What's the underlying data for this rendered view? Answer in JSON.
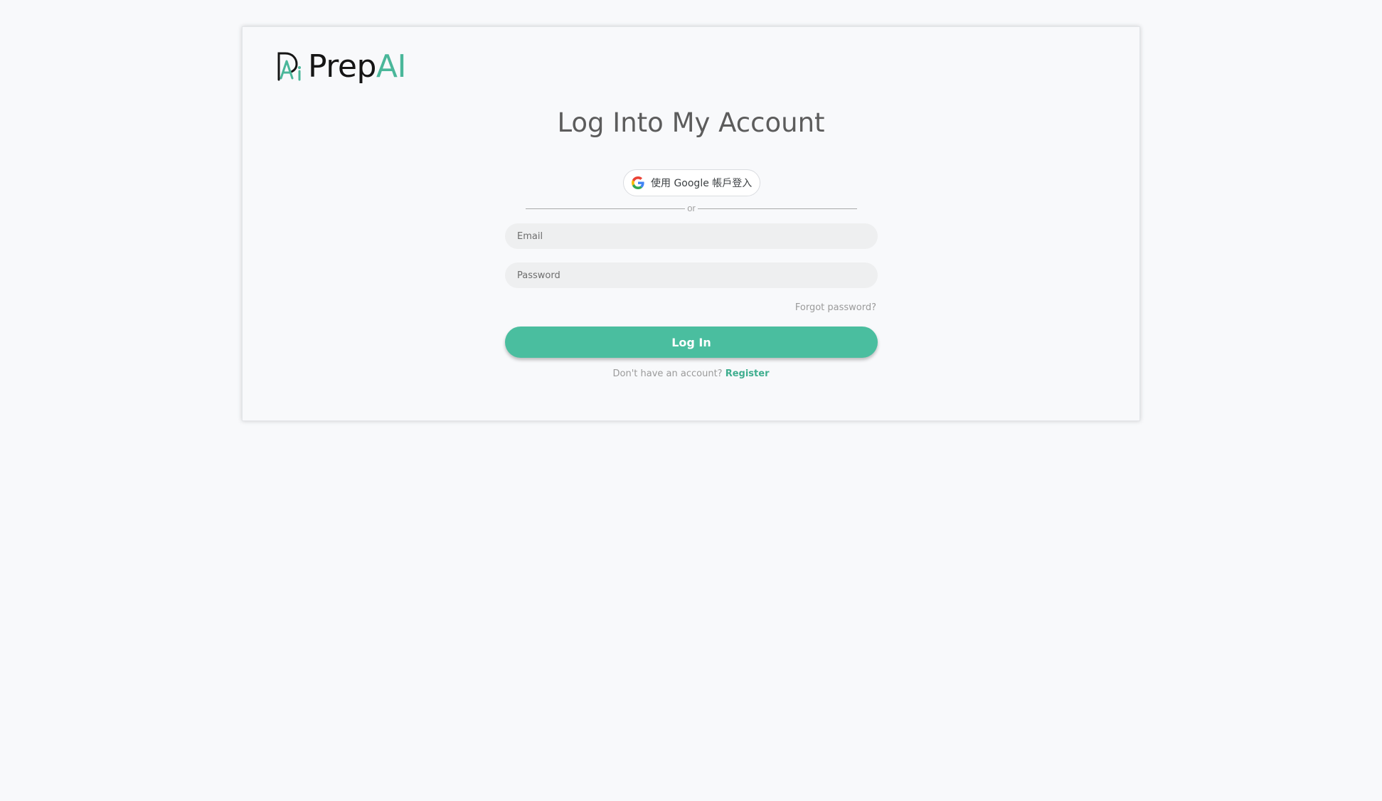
{
  "brand": {
    "name_part1": "Prep",
    "name_part2": "AI",
    "accent_color": "#4ab79a"
  },
  "page": {
    "title": "Log Into My Account"
  },
  "google_signin": {
    "label": "使用 Google 帳戶登入",
    "icon": "google-g-icon"
  },
  "divider": {
    "text": "or"
  },
  "form": {
    "email_placeholder": "Email",
    "email_value": "",
    "password_placeholder": "Password",
    "password_value": "",
    "forgot_label": "Forgot password?",
    "login_label": "Log In",
    "login_color": "#4abe9f"
  },
  "register": {
    "prompt": "Don't have an account?",
    "link_label": "Register"
  }
}
